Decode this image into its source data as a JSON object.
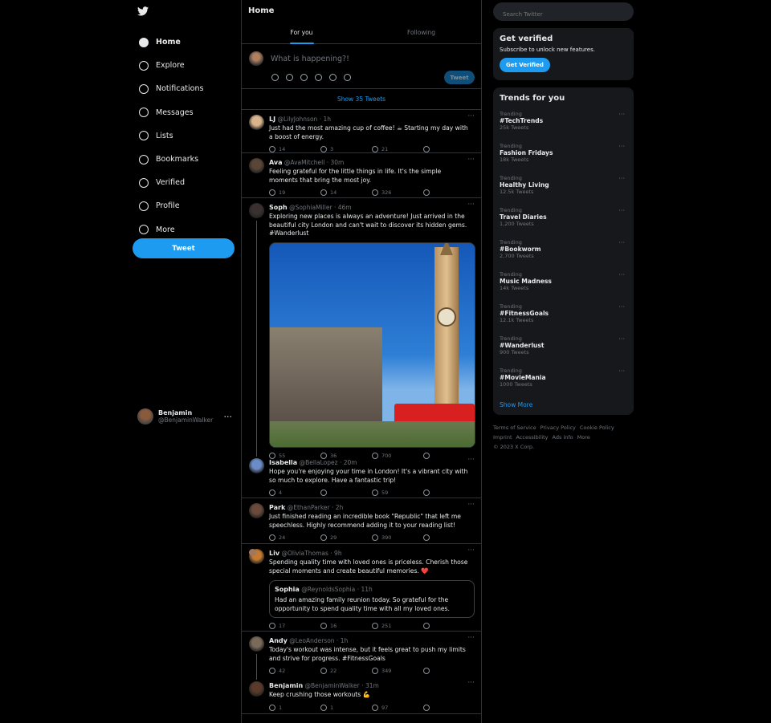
{
  "nav": {
    "items": [
      {
        "label": "Home"
      },
      {
        "label": "Explore"
      },
      {
        "label": "Notifications"
      },
      {
        "label": "Messages"
      },
      {
        "label": "Lists"
      },
      {
        "label": "Bookmarks"
      },
      {
        "label": "Verified"
      },
      {
        "label": "Profile"
      },
      {
        "label": "More"
      }
    ],
    "tweet_label": "Tweet"
  },
  "me": {
    "name": "Benjamin",
    "handle": "@BenjaminWalker"
  },
  "header": {
    "title": "Home",
    "tabs": [
      "For you",
      "Following"
    ]
  },
  "compose": {
    "placeholder": "What is happening?!",
    "button": "Tweet"
  },
  "show_new": "Show 35 Tweets",
  "tweets": [
    {
      "name": "LJ",
      "handle": "@LilyJohnson",
      "time": "1h",
      "text": "Just had the most amazing cup of coffee! ☕ Starting my day with a boost of energy.",
      "replies": "14",
      "retweets": "3",
      "likes": "21"
    },
    {
      "name": "Ava",
      "handle": "@AvaMitchell",
      "time": "30m",
      "text": "Feeling grateful for the little things in life. It's the simple moments that bring the most joy.",
      "replies": "19",
      "retweets": "14",
      "likes": "326"
    },
    {
      "name": "Soph",
      "handle": "@SophiaMiller",
      "time": "46m",
      "text": "Exploring new places is always an adventure! Just arrived in the beautiful city London and can't wait to discover its hidden gems. #Wanderlust",
      "replies": "55",
      "retweets": "36",
      "likes": "700"
    },
    {
      "name": "Isabella",
      "handle": "@BellaLopez",
      "time": "20m",
      "text": "Hope you're enjoying your time in London! It's a vibrant city with so much to explore. Have a fantastic trip!",
      "replies": "4",
      "retweets": "",
      "likes": "59"
    },
    {
      "name": "Park",
      "handle": "@EthanParker",
      "time": "2h",
      "text": "Just finished reading an incredible book \"Republic\" that left me speechless. Highly recommend adding it to your reading list!",
      "replies": "24",
      "retweets": "29",
      "likes": "390"
    },
    {
      "name": "Liv",
      "handle": "@OliviaThomas",
      "time": "9h",
      "text": "Spending quality time with loved ones is priceless. Cherish those special moments and create beautiful memories. ❤️",
      "replies": "17",
      "retweets": "16",
      "likes": "251",
      "quote": {
        "name": "Sophia",
        "handle": "@ReynoldsSophia",
        "time": "11h",
        "text": "Had an amazing family reunion today. So grateful for the opportunity to spend quality time with all my loved ones."
      }
    },
    {
      "name": "Andy",
      "handle": "@LeoAnderson",
      "time": "1h",
      "text": "Today's workout was intense, but it feels great to push my limits and strive for progress. #FitnessGoals",
      "replies": "42",
      "retweets": "22",
      "likes": "349"
    },
    {
      "name": "Benjamin",
      "handle": "@BenjaminWalker",
      "time": "31m",
      "text": "Keep crushing those workouts 💪",
      "replies": "1",
      "retweets": "1",
      "likes": "97"
    }
  ],
  "search": {
    "placeholder": "Search Twitter"
  },
  "verified": {
    "title": "Get verified",
    "text": "Subscribe to unlock new features.",
    "button": "Get Verified"
  },
  "trends": {
    "title": "Trends for you",
    "label": "Trending",
    "items": [
      {
        "topic": "#TechTrends",
        "count": "25k Tweets"
      },
      {
        "topic": "Fashion Fridays",
        "count": "18k Tweets"
      },
      {
        "topic": "Healthy Living",
        "count": "12.5k Tweets"
      },
      {
        "topic": "Travel Diaries",
        "count": "1,200 Tweets"
      },
      {
        "topic": "#Bookworm",
        "count": "2,700 Tweets"
      },
      {
        "topic": "Music Madness",
        "count": "14k Tweets"
      },
      {
        "topic": "#FitnessGoals",
        "count": "12.1k Tweets"
      },
      {
        "topic": "#Wanderlust",
        "count": "900 Tweets"
      },
      {
        "topic": "#MovieMania",
        "count": "1000 Tweets"
      }
    ],
    "show_more": "Show More"
  },
  "footer": [
    "Terms of Service",
    "Privacy Policy",
    "Cookie Policy",
    "Imprint",
    "Accessibility",
    "Ads info",
    "More",
    "© 2023 X Corp."
  ],
  "colors": {
    "accent": "#1d9bf0",
    "bg": "#000000",
    "card": "#16181c"
  }
}
